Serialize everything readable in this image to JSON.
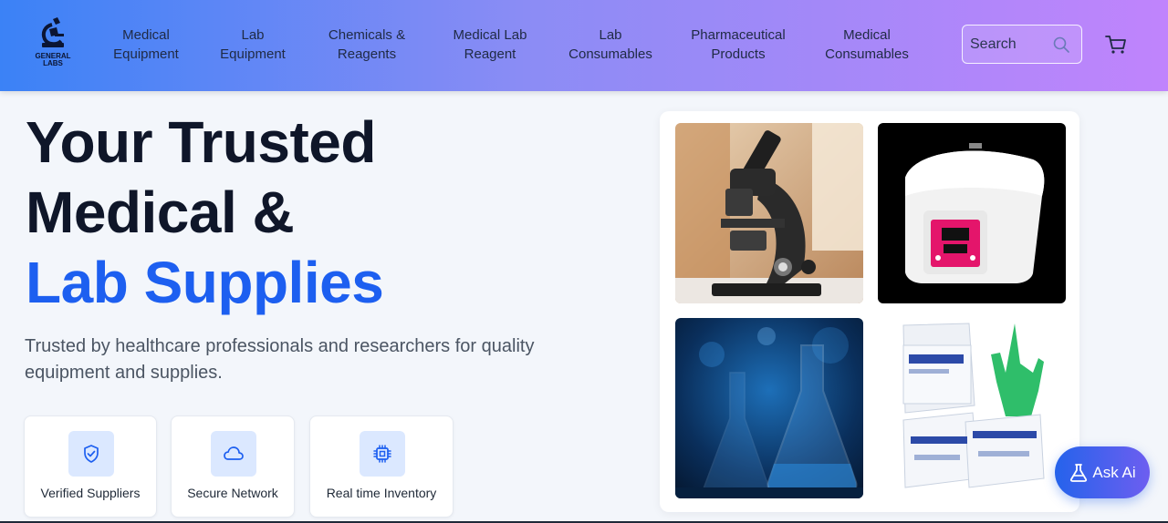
{
  "header": {
    "logo": {
      "line1": "GENERAL",
      "line2": "LABS"
    },
    "nav": [
      {
        "line1": "Medical",
        "line2": "Equipment"
      },
      {
        "line1": "Lab",
        "line2": "Equipment"
      },
      {
        "line1": "Chemicals &",
        "line2": "Reagents"
      },
      {
        "line1": "Medical Lab",
        "line2": "Reagent"
      },
      {
        "line1": "Lab",
        "line2": "Consumables"
      },
      {
        "line1": "Pharmaceutical",
        "line2": "Products"
      },
      {
        "line1": "Medical",
        "line2": "Consumables"
      }
    ],
    "search": {
      "placeholder": "Search",
      "icon": "search-icon"
    },
    "cart_icon": "cart-icon"
  },
  "hero": {
    "title_line1": "Your Trusted",
    "title_line2": "Medical &",
    "title_line3": "Lab Supplies",
    "subtitle": "Trusted by healthcare professionals and researchers for quality equipment and supplies."
  },
  "features": [
    {
      "label": "Verified Suppliers",
      "icon": "shield-check-icon"
    },
    {
      "label": "Secure Network",
      "icon": "cloud-icon"
    },
    {
      "label": "Real time Inventory",
      "icon": "cpu-chip-icon"
    }
  ],
  "gallery": [
    {
      "subject": "microscope"
    },
    {
      "subject": "centrifuge"
    },
    {
      "subject": "lab-flask"
    },
    {
      "subject": "surgical-gloves"
    }
  ],
  "ask_ai": {
    "label": "Ask Ai",
    "icon": "flask-icon"
  },
  "colors": {
    "accent": "#1d5ff0",
    "header_gradient_start": "#3b82f6",
    "header_gradient_end": "#c084fc",
    "feature_icon_bg": "#dbe8ff"
  }
}
